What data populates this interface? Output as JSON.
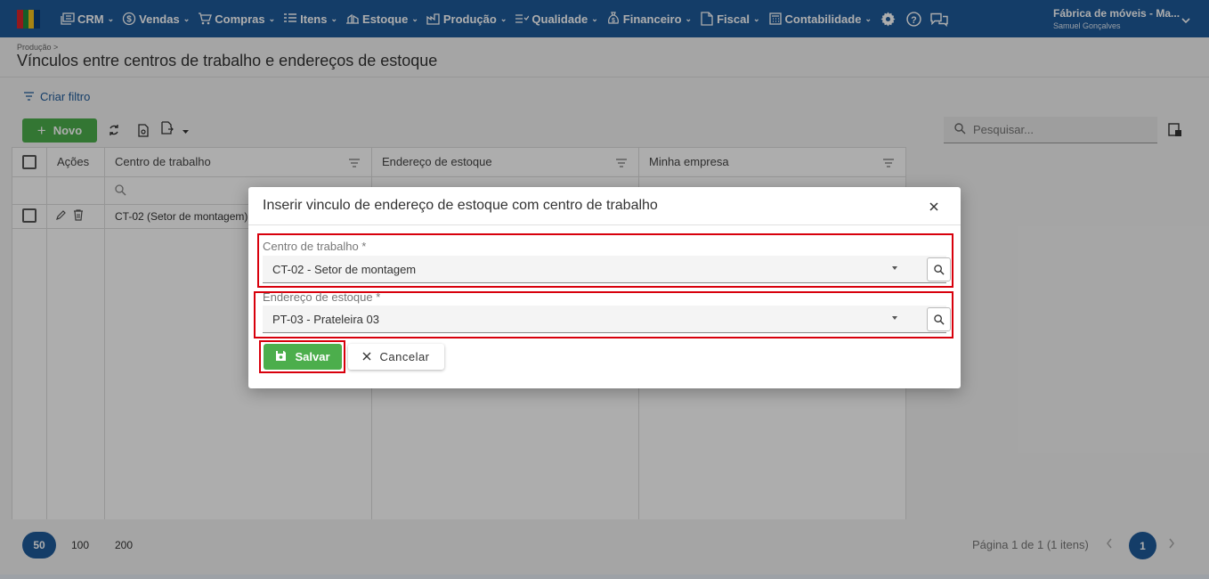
{
  "nav": {
    "items": [
      {
        "label": "CRM",
        "icon": "crm-icon"
      },
      {
        "label": "Vendas",
        "icon": "dollar-icon"
      },
      {
        "label": "Compras",
        "icon": "cart-icon"
      },
      {
        "label": "Itens",
        "icon": "items-icon"
      },
      {
        "label": "Estoque",
        "icon": "stock-icon"
      },
      {
        "label": "Produção",
        "icon": "factory-icon"
      },
      {
        "label": "Qualidade",
        "icon": "quality-icon"
      },
      {
        "label": "Financeiro",
        "icon": "money-bag-icon"
      },
      {
        "label": "Fiscal",
        "icon": "document-icon"
      },
      {
        "label": "Contabilidade",
        "icon": "calculator-icon"
      }
    ],
    "company": "Fábrica de móveis - Ma...",
    "user": "Samuel Gonçalves",
    "brand_color": "#1e5a9a"
  },
  "header": {
    "breadcrumb": "Produção >",
    "title": "Vínculos entre centros de trabalho e endereços de estoque"
  },
  "toolbar": {
    "filter_label": "Criar filtro",
    "new_label": "Novo",
    "search_placeholder": "Pesquisar..."
  },
  "grid": {
    "columns": [
      "Ações",
      "Centro de trabalho",
      "Endereço de estoque",
      "Minha empresa"
    ],
    "rows": [
      {
        "centro": "CT-02 (Setor de montagem)",
        "endereco": "",
        "empresa": ""
      }
    ]
  },
  "pager": {
    "sizes": [
      "50",
      "100",
      "200"
    ],
    "active_size": "50",
    "info": "Página 1 de 1 (1 itens)",
    "current_page": "1"
  },
  "modal": {
    "title": "Inserir vinculo de endereço de estoque com centro de trabalho",
    "fields": [
      {
        "label": "Centro de trabalho *",
        "value": "CT-02 - Setor de montagem"
      },
      {
        "label": "Endereço de estoque *",
        "value": "PT-03 - Prateleira 03"
      }
    ],
    "save_label": "Salvar",
    "cancel_label": "Cancelar"
  },
  "colors": {
    "accent_green": "#4cae4c",
    "highlight_red": "#d8000c"
  }
}
